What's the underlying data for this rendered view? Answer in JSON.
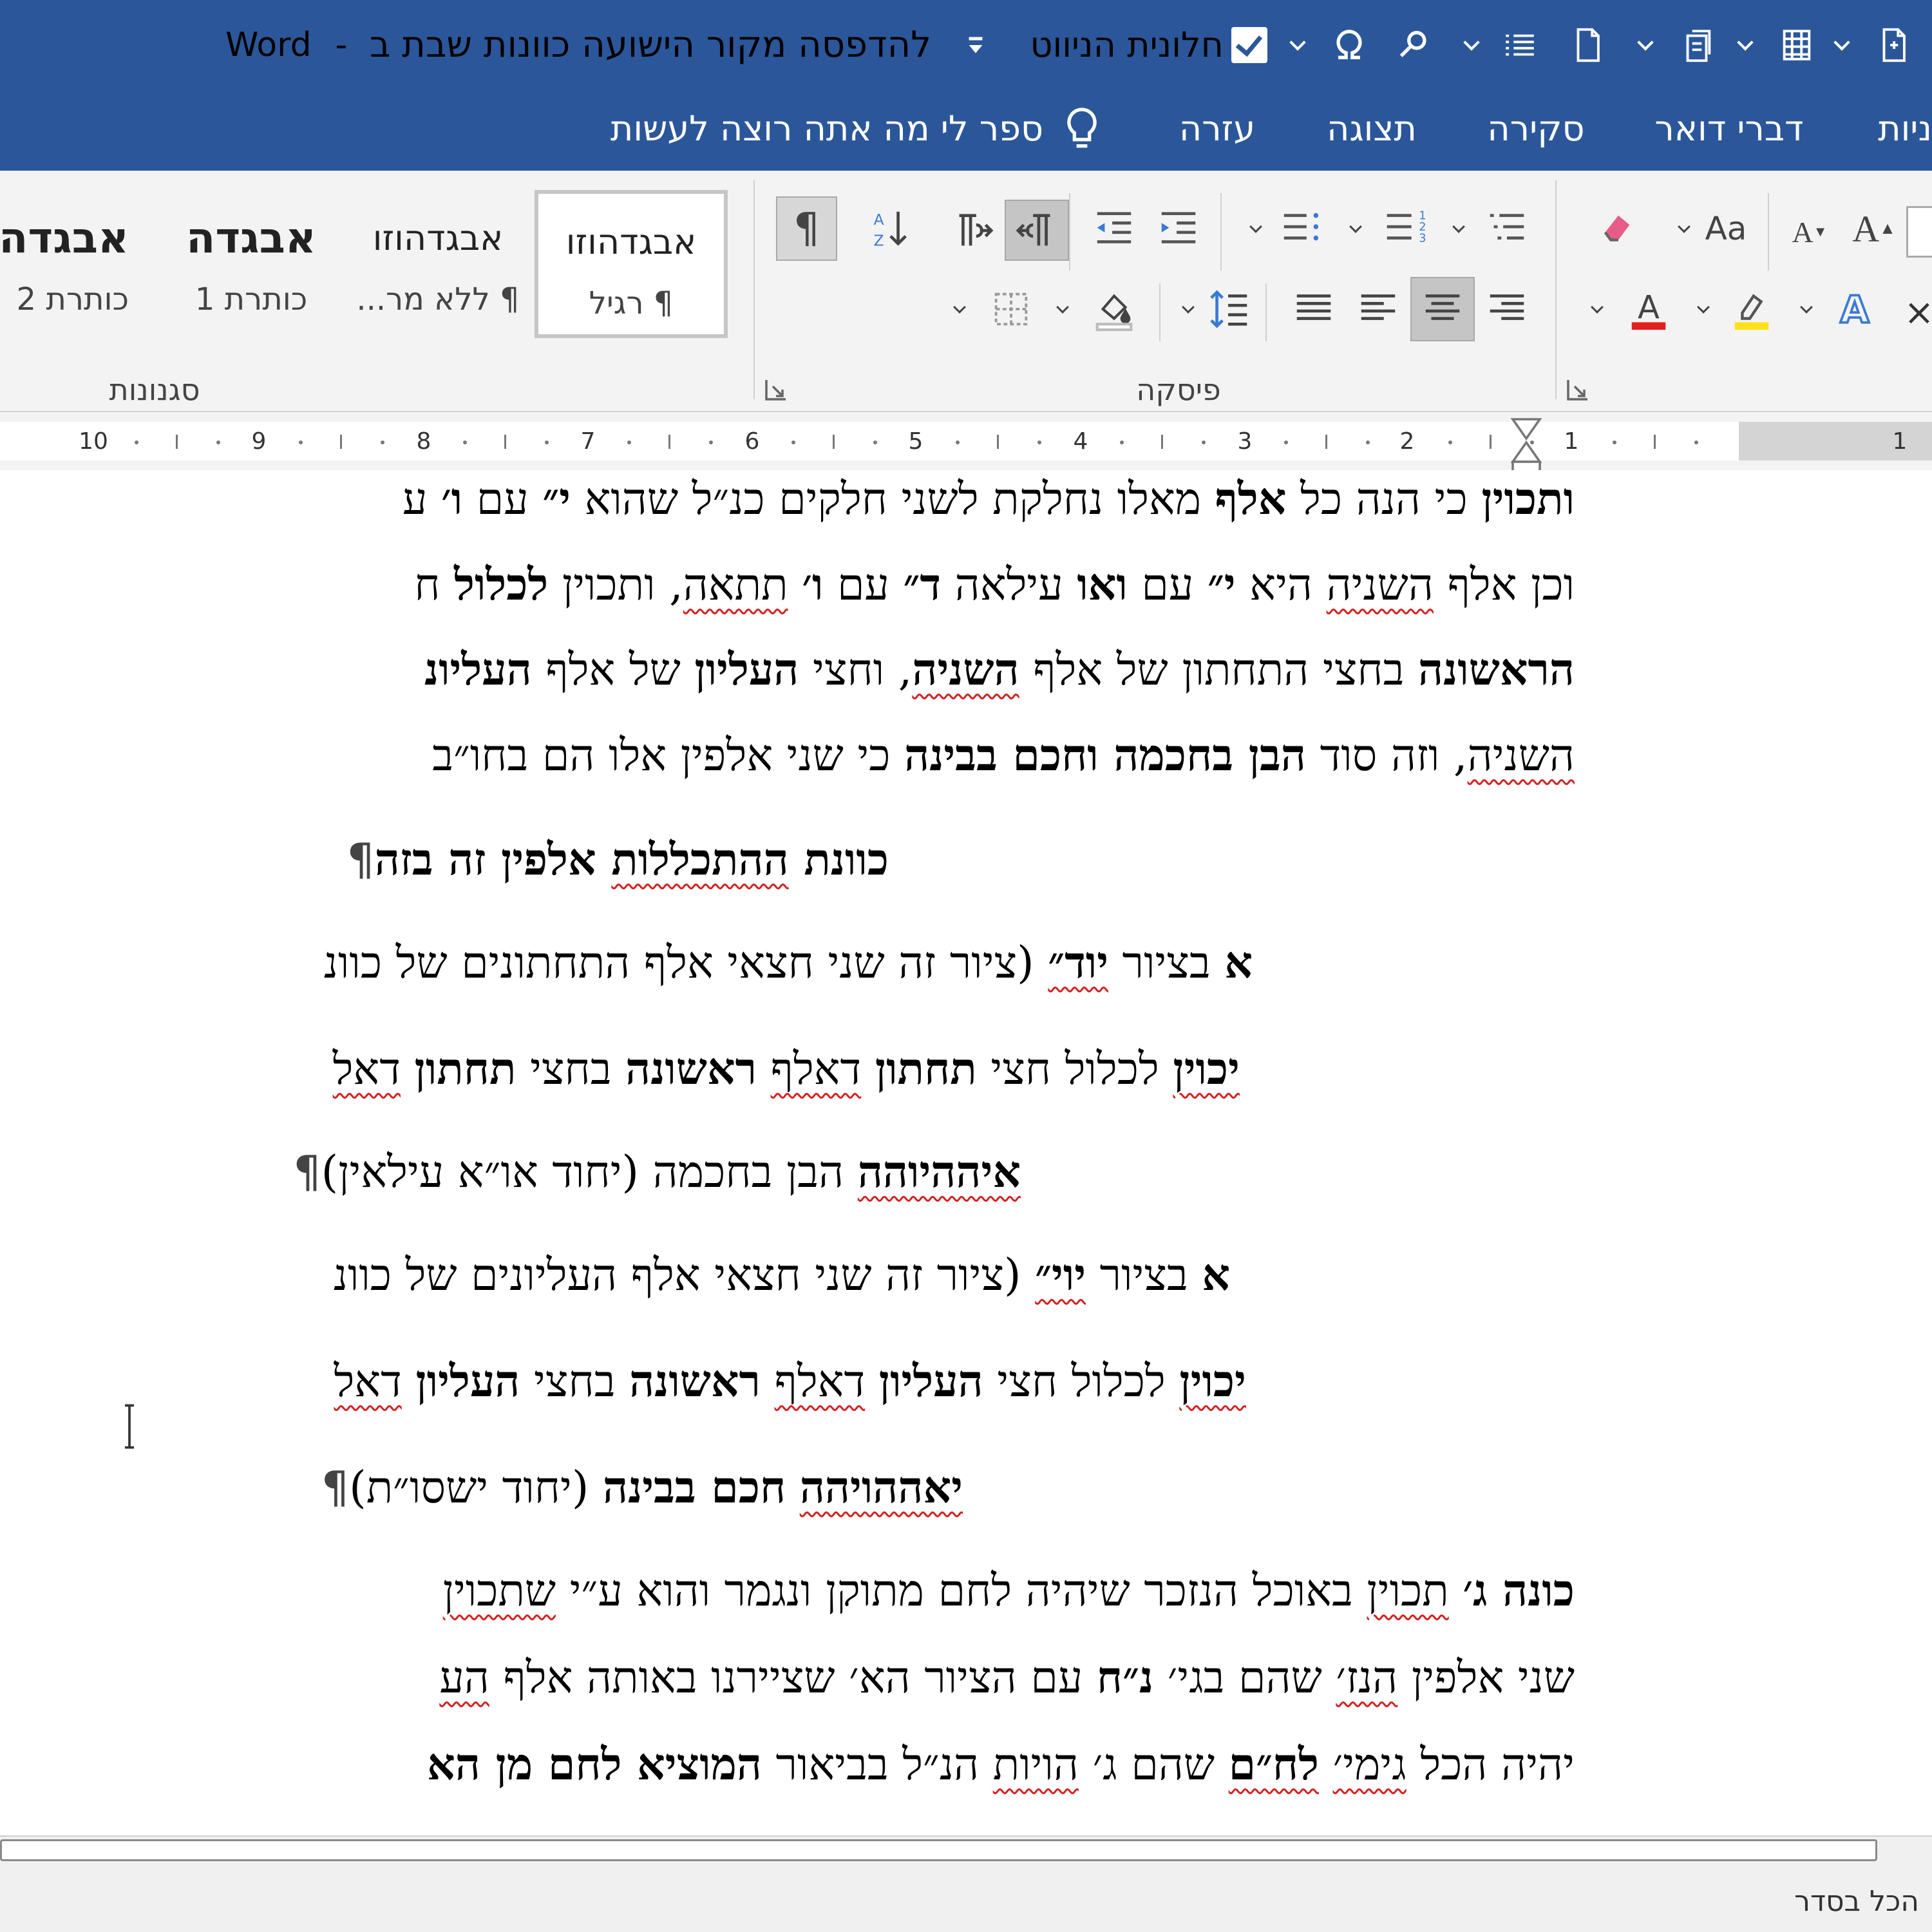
{
  "window": {
    "app_name": "Word",
    "separator": "-",
    "document_title": "להדפסה מקור הישועה כוונות שבת ב",
    "nav_pane_label": "חלונית הניווט"
  },
  "tabs": {
    "partial": "ניות",
    "mailings": "דברי דואר",
    "review": "סקירה",
    "view": "תצוגה",
    "help": "עזרה",
    "tell_me": "ספר לי מה אתה רוצה לעשות"
  },
  "ribbon": {
    "paragraph_group": "פיסקה",
    "styles_group": "סגנונות",
    "font_size_grow": "A",
    "font_size_shrink": "A",
    "change_case": "Aa",
    "styles": [
      {
        "sample": "אבגדהוזו",
        "name": "¶ רגיל"
      },
      {
        "sample": "אבגדהוזו",
        "name": "¶ ללא מר..."
      },
      {
        "sample": "אבגדה",
        "name": "כותרת 1"
      },
      {
        "sample": "אבגדה",
        "name": "כותרת 2"
      }
    ]
  },
  "ruler": {
    "numbers": [
      "10",
      "9",
      "8",
      "7",
      "6",
      "5",
      "4",
      "3",
      "2",
      "1",
      "1"
    ]
  },
  "document": {
    "l1": {
      "a": "ותכוין",
      "b": " כי הנה כל ",
      "c": "אלף",
      "d": " מאלו נחלקת לשני חלקים כנ״ל שהוא ",
      "e": "י״",
      "f": " עם ",
      "g": "ו׳",
      "h": " ע"
    },
    "l2": {
      "a": "וכן אלף ",
      "b": "השניה",
      "c": " היא ",
      "d": "י״",
      "e": " עם ",
      "f": "ואו",
      "g": " עילאה ",
      "h": "ד״",
      "i": " עם ",
      "j": "ו׳",
      "k": " ",
      "l": "תתאה",
      "m": ", ותכוין ",
      "n": "לכלול",
      "o": " ח"
    },
    "l3": {
      "a": "הראשונה",
      "b": " בחצי התחתון של אלף ",
      "c": "השניה",
      "d": ", וחצי ",
      "e": "העליון",
      "f": " של אלף ",
      "g": "העליונ"
    },
    "l4": {
      "a": "השניה",
      "b": ", וזה סוד ",
      "c": "הבן בחכמה וחכם בבינה",
      "d": " כי שני אלפין אלו הם בחו״ב"
    },
    "l5": {
      "a": "כוונת ",
      "b": "ההתכללות",
      "c": " אלפין זה בזה",
      "pil": "¶"
    },
    "l6": {
      "a": "א",
      "b": " בציור ",
      "c": "יוד״",
      "d": " (ציור זה שני חצאי אלף התחתונים של כוונ"
    },
    "l7": {
      "a": "יכוין",
      "b": " לכלול חצי ",
      "c": "תחתון",
      "d": " ",
      "e": "דאלף",
      "f": " ",
      "g": "ראשונה",
      "h": " בחצי ",
      "i": "תחתון",
      "j": " ",
      "k": "דאל"
    },
    "l8": {
      "a": "איההיוהה",
      "b": " הבן בחכמה (יחוד או״א עילאין)",
      "pil": "¶"
    },
    "l9": {
      "a": "א",
      "b": " בציור ",
      "c": "יוי״",
      "d": " (ציור זה שני חצאי אלף העליונים של כוונ"
    },
    "l10": {
      "a": "יכוין",
      "b": " לכלול חצי ",
      "c": "העליון",
      "d": " ",
      "e": "דאלף",
      "f": " ",
      "g": "ראשונה",
      "h": " בחצי ",
      "i": "העליון",
      "j": " ",
      "k": "דאל"
    },
    "l11": {
      "a": "יאההויהה",
      "b": " ",
      "c": "חכם בבינה",
      "d": " (יחוד ישסו״ת)",
      "pil": "¶"
    },
    "l12": {
      "a": "כונה ג׳",
      "b": " ",
      "c": "תכוין",
      "d": " באוכל הנזכר שיהיה לחם מתוקן ונגמר והוא ע״י ",
      "e": "שתכוין"
    },
    "l13": {
      "a": "שני אלפין ",
      "b": "הנז׳",
      "c": " שהם בגי׳ ",
      "d": "נ״ח",
      "e": " עם הציור הא׳ שציירנו באותה אלף ",
      "f": "הע"
    },
    "l14": {
      "a": "יהיה הכל ",
      "b": "גימי׳",
      "c": " ",
      "d": "לח״ם",
      "e": " שהם ג׳ ",
      "f": "הויות",
      "g": " הנ״ל בביאור ",
      "h": "המוציא לחם מן הא"
    }
  },
  "status": {
    "text": "הכל בסדר"
  }
}
